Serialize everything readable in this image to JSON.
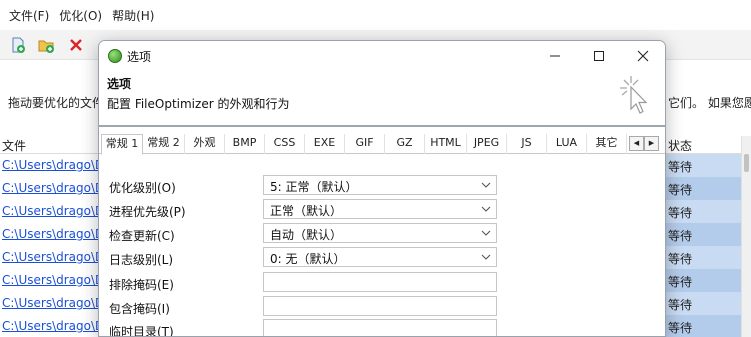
{
  "menu": [
    "文件(F)",
    "优化(O)",
    "帮助(H)"
  ],
  "description": {
    "left_text": "拖动要优化的文件",
    "right_text": "它们。 如果您愿"
  },
  "list": {
    "col_file": "文件",
    "col_status": "状态",
    "rows": [
      {
        "path": "C:\\Users\\drago\\Desk",
        "status": "等待"
      },
      {
        "path": "C:\\Users\\drago\\Desk",
        "status": "等待"
      },
      {
        "path": "C:\\Users\\drago\\Desk",
        "status": "等待"
      },
      {
        "path": "C:\\Users\\drago\\Desk",
        "status": "等待"
      },
      {
        "path": "C:\\Users\\drago\\Desk",
        "status": "等待"
      },
      {
        "path": "C:\\Users\\drago\\Desk",
        "status": "等待"
      },
      {
        "path": "C:\\Users\\drago\\Desk",
        "status": "等待"
      },
      {
        "path": "C:\\Users\\drago\\Desk",
        "status": "等待"
      }
    ]
  },
  "dialog": {
    "title": "选项",
    "banner_title": "选项",
    "banner_subtitle": "配置 FileOptimizer 的外观和行为",
    "tabs": [
      "常规 1",
      "常规 2",
      "外观",
      "BMP",
      "CSS",
      "EXE",
      "GIF",
      "GZ",
      "HTML",
      "JPEG",
      "JS",
      "LUA",
      "其它"
    ],
    "active_tab": "常规 1",
    "fields": {
      "optimize_level": {
        "label": "优化级别(O)",
        "value": "5: 正常（默认）"
      },
      "process_priority": {
        "label": "进程优先级(P)",
        "value": "正常（默认）"
      },
      "check_updates": {
        "label": "检查更新(C)",
        "value": "自动（默认）"
      },
      "log_level": {
        "label": "日志级别(L)",
        "value": "0: 无（默认）"
      },
      "exclude_mask": {
        "label": "排除掩码(E)",
        "value": ""
      },
      "include_mask": {
        "label": "包含掩码(I)",
        "value": ""
      },
      "temp_dir": {
        "label": "临时目录(T)",
        "value": ""
      }
    }
  },
  "colors": {
    "status_cell": "#c9dbf2",
    "status_cell_alt": "#b4cceb",
    "link": "#1a4fd8"
  }
}
